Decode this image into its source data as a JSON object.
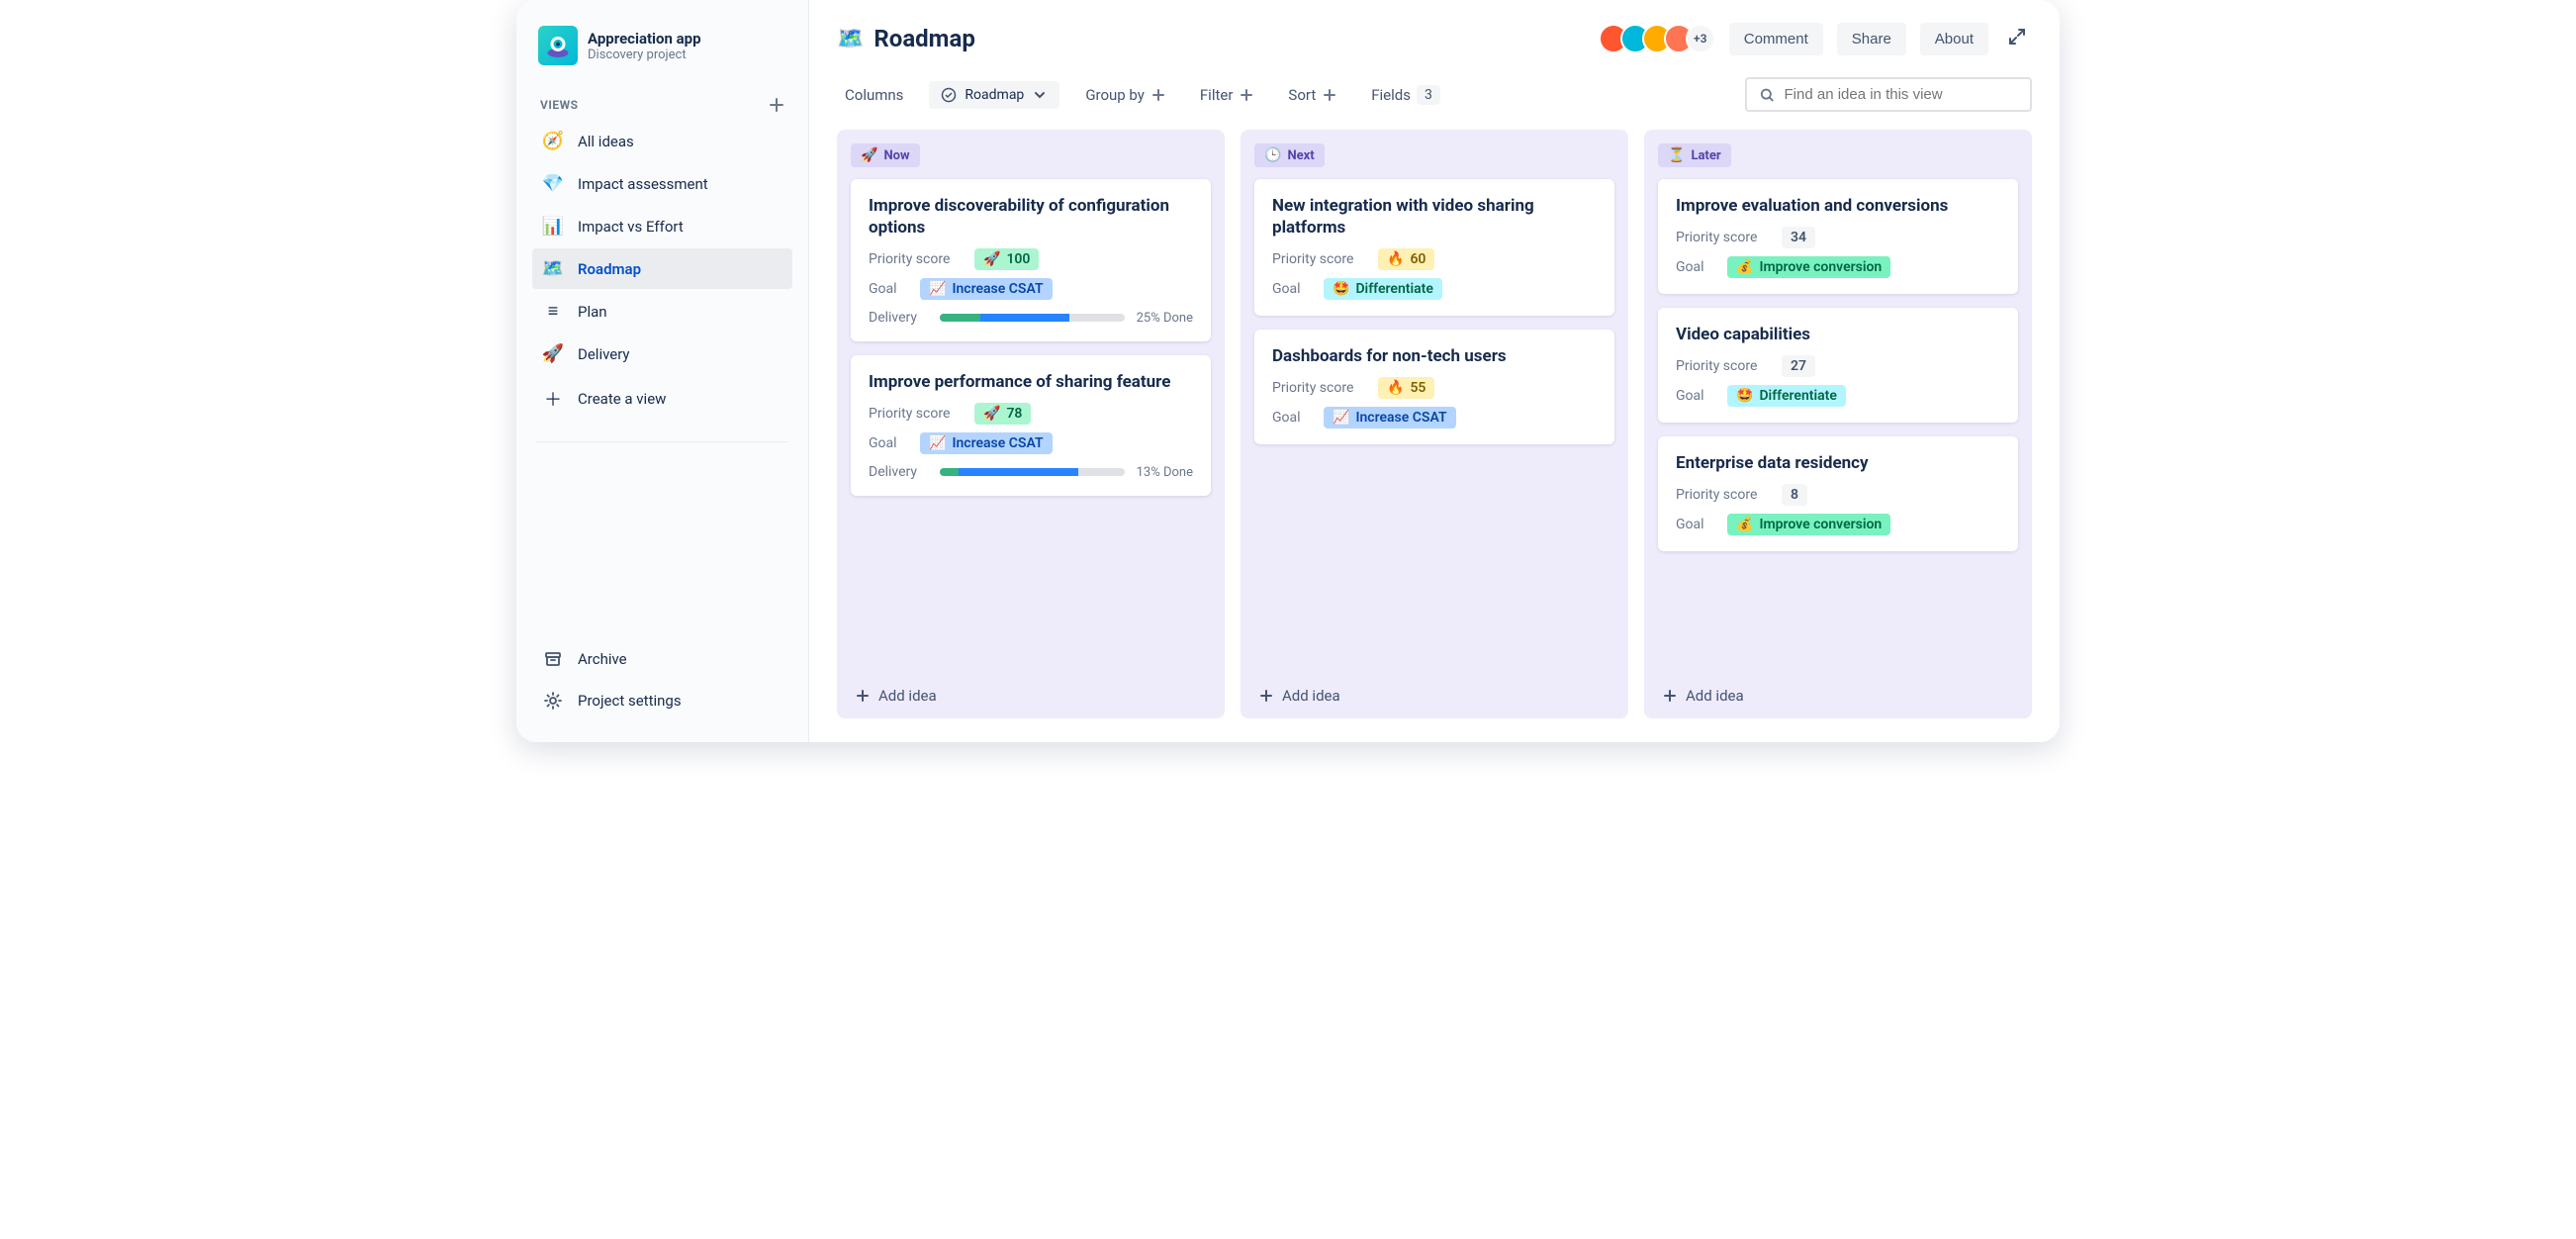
{
  "project": {
    "name": "Appreciation app",
    "subtitle": "Discovery project"
  },
  "sidebar": {
    "views_header": "VIEWS",
    "items": [
      {
        "icon": "🧭",
        "label": "All ideas"
      },
      {
        "icon": "💎",
        "label": "Impact assessment"
      },
      {
        "icon": "📊",
        "label": "Impact vs Effort"
      },
      {
        "icon": "🗺️",
        "label": "Roadmap",
        "active": true
      },
      {
        "icon": "≡",
        "label": "Plan"
      },
      {
        "icon": "🚀",
        "label": "Delivery"
      },
      {
        "icon": "＋",
        "label": "Create a view"
      }
    ],
    "footer": [
      {
        "icon": "archive",
        "label": "Archive"
      },
      {
        "icon": "gear",
        "label": "Project settings"
      }
    ]
  },
  "header": {
    "icon": "🗺️",
    "title": "Roadmap",
    "avatars_overflow": "+3",
    "actions": {
      "comment": "Comment",
      "share": "Share",
      "about": "About"
    }
  },
  "toolbar": {
    "columns": "Columns",
    "column_selector": "Roadmap",
    "groupby": "Group by",
    "filter": "Filter",
    "sort": "Sort",
    "fields": "Fields",
    "fields_count": "3",
    "search_placeholder": "Find an idea in this view"
  },
  "board": {
    "add_idea": "Add idea",
    "field_labels": {
      "priority": "Priority score",
      "goal": "Goal",
      "delivery": "Delivery"
    },
    "columns": [
      {
        "id": "now",
        "icon": "🚀",
        "title": "Now",
        "cards": [
          {
            "title": "Improve discoverability of configuration options",
            "priority": {
              "style": "rocket",
              "icon": "🚀",
              "value": "100"
            },
            "goal": {
              "style": "csat",
              "icon": "📈",
              "label": "Increase CSAT"
            },
            "delivery": {
              "green": 22,
              "blue": 48,
              "text": "25% Done"
            }
          },
          {
            "title": "Improve performance of sharing feature",
            "priority": {
              "style": "rocket",
              "icon": "🚀",
              "value": "78"
            },
            "goal": {
              "style": "csat",
              "icon": "📈",
              "label": "Increase CSAT"
            },
            "delivery": {
              "green": 10,
              "blue": 65,
              "text": "13% Done"
            }
          }
        ]
      },
      {
        "id": "next",
        "icon": "🕒",
        "title": "Next",
        "cards": [
          {
            "title": "New integration with video sharing platforms",
            "priority": {
              "style": "fire",
              "icon": "🔥",
              "value": "60"
            },
            "goal": {
              "style": "diff",
              "icon": "🤩",
              "label": "Differentiate"
            }
          },
          {
            "title": "Dashboards for non-tech users",
            "priority": {
              "style": "fire",
              "icon": "🔥",
              "value": "55"
            },
            "goal": {
              "style": "csat",
              "icon": "📈",
              "label": "Increase CSAT"
            }
          }
        ]
      },
      {
        "id": "later",
        "icon": "⏳",
        "title": "Later",
        "cards": [
          {
            "title": "Improve evaluation and conversions",
            "priority": {
              "style": "gray",
              "value": "34"
            },
            "goal": {
              "style": "conv",
              "icon": "💰",
              "label": "Improve conversion"
            }
          },
          {
            "title": "Video capabilities",
            "priority": {
              "style": "gray",
              "value": "27"
            },
            "goal": {
              "style": "diff",
              "icon": "🤩",
              "label": "Differentiate"
            }
          },
          {
            "title": "Enterprise data residency",
            "priority": {
              "style": "gray",
              "value": "8"
            },
            "goal": {
              "style": "conv",
              "icon": "💰",
              "label": "Improve conversion"
            }
          }
        ]
      }
    ]
  },
  "avatar_colors": [
    "#FF5630",
    "#00B8D9",
    "#FFAB00",
    "#FF7452"
  ]
}
